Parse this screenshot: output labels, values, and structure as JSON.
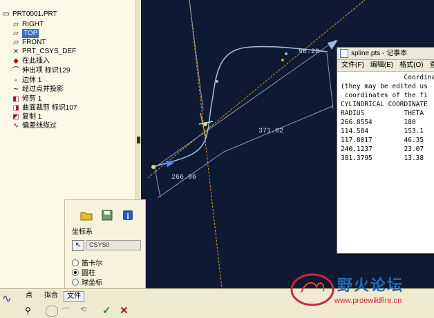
{
  "tree": {
    "items": [
      {
        "icon": "part-icon",
        "label": "PRT0001.PRT"
      },
      {
        "icon": "datum-plane-icon",
        "label": "RIGHT"
      },
      {
        "icon": "datum-plane-icon",
        "label": "TOP"
      },
      {
        "icon": "datum-plane-icon",
        "label": "FRONT"
      },
      {
        "icon": "csys-icon",
        "label": "PRT_CSYS_DEF"
      },
      {
        "icon": "insert-here-icon",
        "label": "在此插入"
      },
      {
        "icon": "extrude-icon",
        "label": "伸出项 标识129"
      },
      {
        "icon": "shell-icon",
        "label": "边休 1"
      },
      {
        "icon": "curve-icon",
        "label": "经过点并投影"
      },
      {
        "icon": "trim-icon",
        "label": "修剪 1"
      },
      {
        "icon": "surface-trim-icon",
        "label": "曲面裁剪 标识107"
      },
      {
        "icon": "copy-icon",
        "label": "复制 1"
      },
      {
        "icon": "spline-icon",
        "label": "偏差线缆过"
      }
    ]
  },
  "viewport": {
    "dim_top": "98.28",
    "dim_middle": "371.02",
    "dim_left": "266.06"
  },
  "notepad": {
    "title": "spline.pts - 记事本",
    "menu": [
      "文件(F)",
      "编辑(E)",
      "格式(O)",
      "查看"
    ],
    "lines": [
      "                Coordina",
      "(they may be edited us",
      " coordinates of the fi",
      "",
      "CYLINDRICAL COORDINATE",
      "",
      "RADIUS          THETA",
      "266.8554        180",
      "114.584         153.1",
      "117.8017        46.35",
      "240.1237        23.07",
      "381.3795        13.38"
    ]
  },
  "dialog": {
    "label": "坐标系",
    "csys_value": "CSYS0",
    "options": [
      {
        "label": "笛卡尔",
        "selected": false
      },
      {
        "label": "圆柱",
        "selected": true
      },
      {
        "label": "球坐标",
        "selected": false
      }
    ]
  },
  "dashboard": {
    "tabs": [
      "点",
      "拟合",
      "文件"
    ],
    "active_tab": "文件"
  },
  "watermark": {
    "title": "野火论坛",
    "url": "www.proewildfire.cn"
  },
  "colors": {
    "viewport_bg": "#0e1a33",
    "axis": "#e0a020",
    "spline": "#9fb8e0",
    "selection": "#3a6ac8"
  }
}
